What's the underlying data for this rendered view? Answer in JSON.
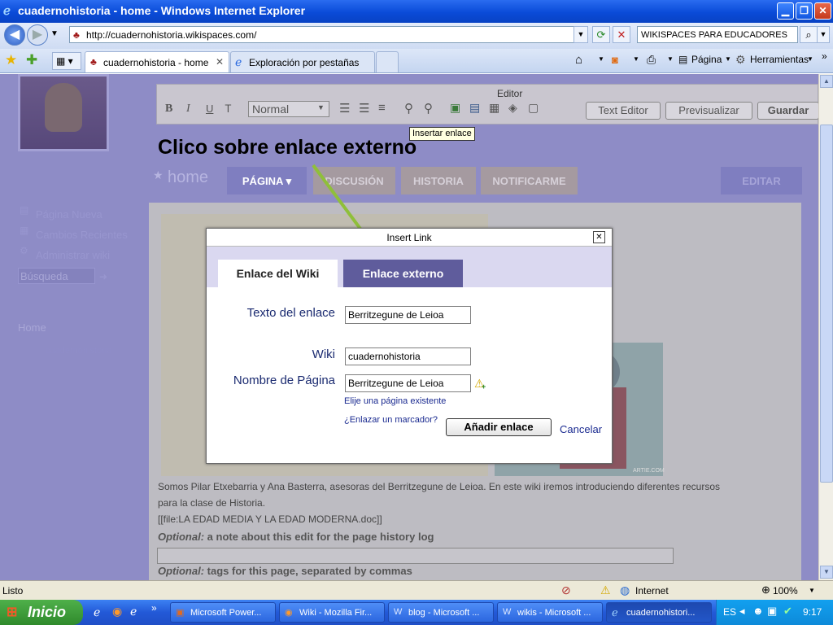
{
  "window": {
    "title": "cuadernohistoria - home - Windows Internet Explorer"
  },
  "address": {
    "url": "http://cuadernohistoria.wikispaces.com/",
    "search": "WIKISPACES PARA EDUCADORES"
  },
  "tabs": [
    {
      "label": "cuadernohistoria - home"
    },
    {
      "label": "Exploración por pestañas"
    }
  ],
  "toolbar": {
    "page": "Página",
    "tools": "Herramientas"
  },
  "editor": {
    "title": "Editor",
    "format": "Normal",
    "text_editor": "Text Editor",
    "preview": "Previsualizar",
    "save": "Guardar",
    "tooltip": "Insertar enlace"
  },
  "annotation": "Clico sobre enlace externo",
  "wiki": {
    "home": "home",
    "tabs": [
      "PÁGINA ▾",
      "DISCUSIÓN",
      "HISTORIA",
      "NOTIFICARME"
    ],
    "edit": "EDITAR",
    "sidebar": [
      "Página Nueva",
      "Cambios Recientes",
      "Administrar wiki"
    ],
    "search_placeholder": "Búsqueda",
    "home_link": "Home",
    "sub_link": "cuadernohistoria"
  },
  "dialog": {
    "title": "Insert Link",
    "tab_wiki": "Enlace del Wiki",
    "tab_external": "Enlace externo",
    "label_text": "Texto del enlace",
    "value_text": "Berritzegune de Leioa",
    "label_wiki": "Wiki",
    "value_wiki": "cuadernohistoria",
    "label_page": "Nombre de Página",
    "value_page": "Berritzegune de Leioa",
    "choose_page": "Elije una página existente",
    "bookmark": "¿Enlazar un marcador?",
    "add": "Añadir enlace",
    "cancel": "Cancelar"
  },
  "content": {
    "para1": "Somos Pilar Etxebarria y Ana Basterra, asesoras del Berritzegune de Leioa. En este wiki iremos introduciendo diferentes recursos",
    "para2": "para la clase de Historia.",
    "file": "[[file:LA EDAD MEDIA Y LA EDAD MODERNA.doc]]",
    "opt1_prefix": "Optional:",
    "opt1": " a note about this edit for the page history log",
    "opt2_prefix": "Optional:",
    "opt2": " tags for this page, separated by commas",
    "artie": "ARTIE.COM"
  },
  "status": {
    "text": "Listo",
    "zone": "Internet",
    "zoom": "100%"
  },
  "taskbar": {
    "start": "Inicio",
    "items": [
      "Microsoft Power...",
      "Wiki - Mozilla Fir...",
      "blog - Microsoft ...",
      "wikis - Microsoft ...",
      "cuadernohistori..."
    ],
    "lang": "ES",
    "time": "9:17"
  }
}
